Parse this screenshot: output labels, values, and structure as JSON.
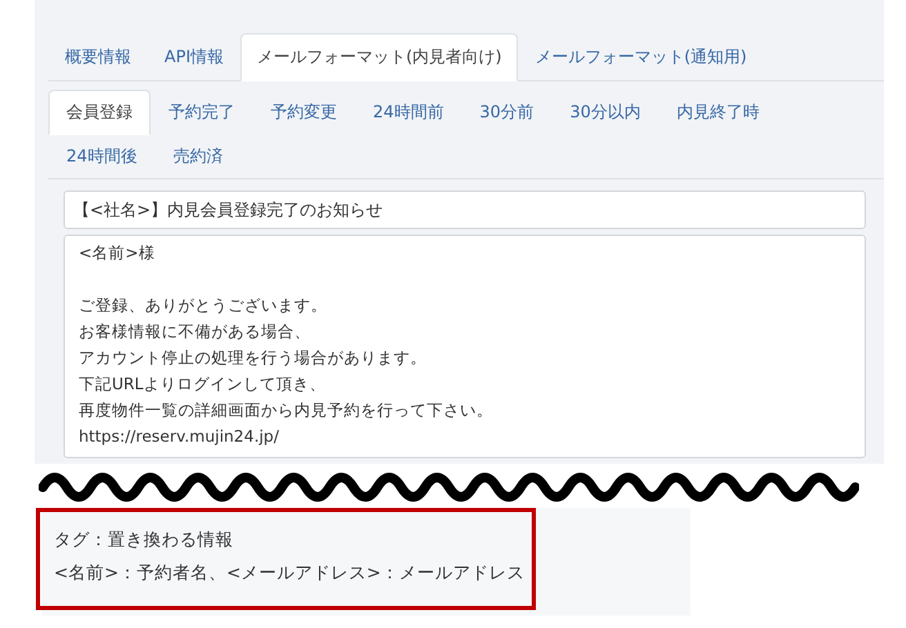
{
  "tabs": [
    {
      "label": "概要情報",
      "selected": false
    },
    {
      "label": "API情報",
      "selected": false
    },
    {
      "label": "メールフォーマット(内見者向け)",
      "selected": true
    },
    {
      "label": "メールフォーマット(通知用)",
      "selected": false
    }
  ],
  "sub_tabs": [
    {
      "label": "会員登録",
      "selected": true
    },
    {
      "label": "予約完了",
      "selected": false
    },
    {
      "label": "予約変更",
      "selected": false
    },
    {
      "label": "24時間前",
      "selected": false
    },
    {
      "label": "30分前",
      "selected": false
    },
    {
      "label": "30分以内",
      "selected": false
    },
    {
      "label": "内見終了時",
      "selected": false
    },
    {
      "label": "24時間後",
      "selected": false
    },
    {
      "label": "売約済",
      "selected": false
    }
  ],
  "subject": {
    "value": "【<社名>】内見会員登録完了のお知らせ"
  },
  "body": {
    "paragraphs": [
      [
        "<名前>様"
      ],
      [
        "ご登録、ありがとうございます。",
        "お客様情報に不備がある場合、",
        "アカウント停止の処理を行う場合があります。",
        "下記URLよりログインして頂き、",
        "再度物件一覧の詳細画面から内見予約を行って下さい。",
        "https://reserv.mujin24.jp/"
      ]
    ]
  },
  "note": {
    "lines": [
      "タグ：置き換わる情報",
      "<名前>：予約者名、<メールアドレス>：メールアドレス"
    ]
  }
}
